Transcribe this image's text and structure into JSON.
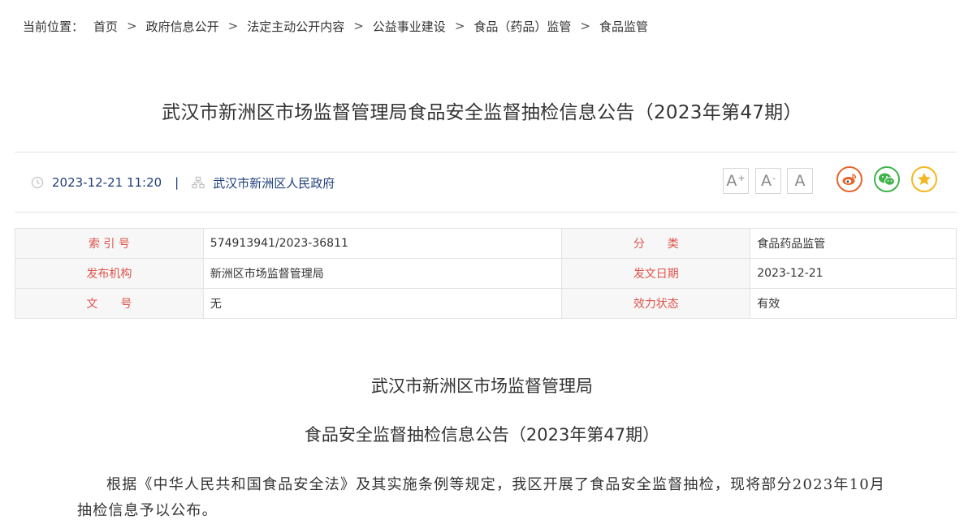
{
  "breadcrumb": {
    "lead": "当前位置：",
    "items": [
      "首页",
      "政府信息公开",
      "法定主动公开内容",
      "公益事业建设",
      "食品（药品）监管",
      "食品监管"
    ],
    "separator": ">"
  },
  "article": {
    "title": "武汉市新洲区市场监督管理局食品安全监督抽检信息公告（2023年第47期）",
    "datetime": "2023-12-21 11:20",
    "divider": "|",
    "source": "武汉市新洲区人民政府"
  },
  "toolbar": {
    "font_increase": "A",
    "font_increase_mark": "+",
    "font_decrease": "A",
    "font_decrease_mark": "-",
    "font_reset": "A",
    "share_icons": [
      "weibo-icon",
      "wechat-icon",
      "favorite-star-icon"
    ]
  },
  "info_table": {
    "rows": [
      {
        "label1": "索 引 号",
        "value1": "574913941/2023-36811",
        "label2": "分　　类",
        "value2": "食品药品监管"
      },
      {
        "label1": "发布机构",
        "value1": "新洲区市场监督管理局",
        "label2": "发文日期",
        "value2": "2023-12-21"
      },
      {
        "label1": "文　　号",
        "value1": "无",
        "label2": "效力状态",
        "value2": "有效"
      }
    ]
  },
  "body": {
    "heading1": "武汉市新洲区市场监督管理局",
    "heading2": "食品安全监督抽检信息公告（2023年第47期）",
    "paragraph": "根据《中华人民共和国食品安全法》及其实施条例等规定，我区开展了食品安全监督抽检，现将部分2023年10月抽检信息予以公布。"
  },
  "colors": {
    "label_red": "#e0534a",
    "meta_blue": "#1f3f7a",
    "weibo": "#e6632b",
    "wechat": "#3fb34a",
    "star": "#f2b81e"
  }
}
